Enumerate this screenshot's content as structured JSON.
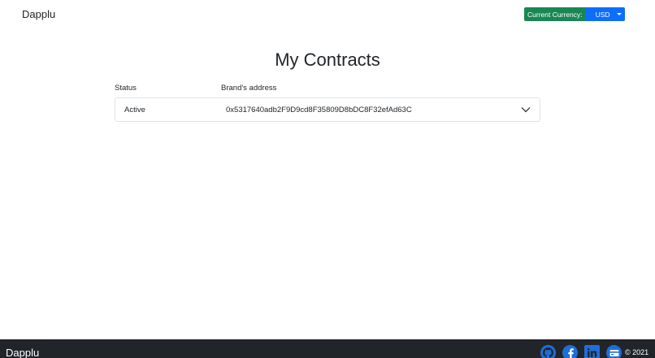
{
  "header": {
    "brand": "Dapplu",
    "currency_label": "Current Currency:",
    "currency_value": "USD"
  },
  "main": {
    "title": "My Contracts",
    "columns": {
      "status": "Status",
      "address": "Brand's address"
    },
    "contracts": [
      {
        "status": "Active",
        "address": "0x5317640adb2F9D9cd8F35809D8bDC8F32efAd63C"
      }
    ]
  },
  "footer": {
    "brand": "Dapplu",
    "copyright": "© 2021",
    "social_icons": [
      "github-icon",
      "facebook-icon",
      "linkedin-icon",
      "wallet-icon"
    ]
  },
  "colors": {
    "currency_label_bg": "#198754",
    "currency_select_bg": "#0d6efd",
    "footer_bg": "#212529",
    "social_blue": "#1d6fd8"
  }
}
